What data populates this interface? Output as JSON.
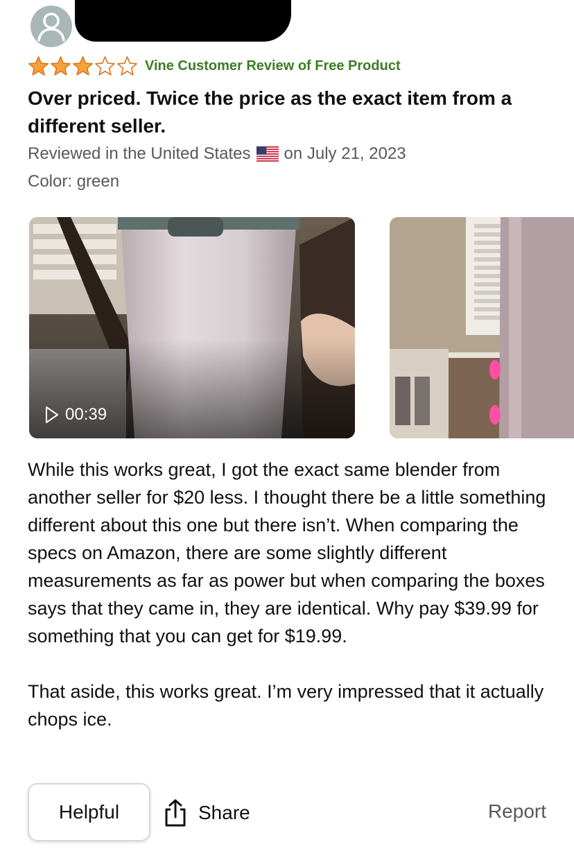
{
  "review": {
    "reviewer_name_redacted": true,
    "rating": 3,
    "rating_max": 5,
    "badge": "Vine Customer Review of Free Product",
    "title": "Over priced. Twice the price as the exact item from a different seller.",
    "reviewed_prefix": "Reviewed in the United States",
    "reviewed_date": "on July 21, 2023",
    "variant": "Color: green",
    "media": [
      {
        "type": "video",
        "duration": "00:39",
        "icon": "play-icon"
      },
      {
        "type": "image"
      }
    ],
    "body_paragraphs": [
      "While this works great, I got the exact same blender from another seller for $20 less. I thought there be a little something different about this one but there isn’t. When comparing the specs on Amazon, there are some slightly different measurements as far as power but when comparing the boxes says that they came in, they are identical. Why pay $39.99 for something that you can get for $19.99.",
      "That aside, this works great. I’m very impressed that it actually chops ice."
    ]
  },
  "actions": {
    "helpful_label": "Helpful",
    "share_label": "Share",
    "report_label": "Report"
  },
  "colors": {
    "star_fill": "#f4a33a",
    "star_outline": "#de7921",
    "vine_green": "#3b7d23",
    "meta_gray": "#565959",
    "text": "#0f1111"
  },
  "icons": [
    "user-icon",
    "star-icon",
    "us-flag-icon",
    "play-icon",
    "share-icon"
  ]
}
